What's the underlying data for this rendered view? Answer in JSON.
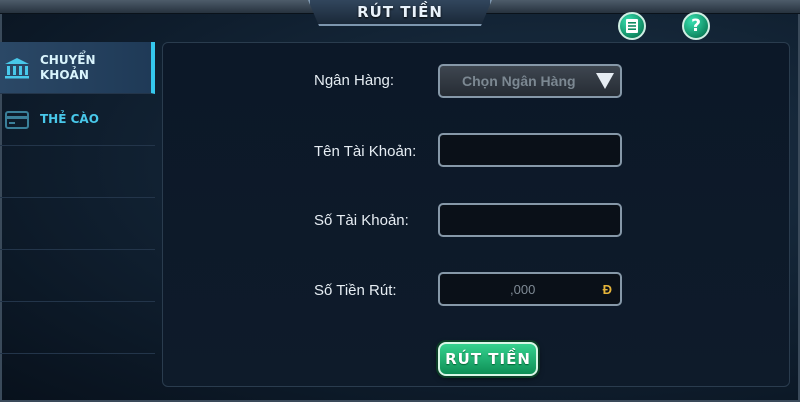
{
  "header": {
    "title": "RÚT TIỀN",
    "doc_icon": "document-icon",
    "help_icon": "help-icon",
    "help_glyph": "?"
  },
  "sidebar": {
    "items": [
      {
        "label": "CHUYỂN KHOẢN",
        "icon": "bank-icon",
        "active": true
      },
      {
        "label": "THẺ CÀO",
        "icon": "card-icon",
        "active": false
      }
    ]
  },
  "form": {
    "bank": {
      "label": "Ngân Hàng:",
      "selected": "Chọn Ngân Hàng"
    },
    "account_name": {
      "label": "Tên Tài Khoản:",
      "value": ""
    },
    "account_number": {
      "label": "Số Tài Khoản:",
      "value": ""
    },
    "amount": {
      "label": "Số Tiền Rút:",
      "placeholder": ",000",
      "currency": "Đ"
    },
    "submit_label": "RÚT TIỀN"
  },
  "colors": {
    "accent_cyan": "#35c8ee",
    "button_green": "#1fb774",
    "currency_gold": "#e5b43a"
  }
}
